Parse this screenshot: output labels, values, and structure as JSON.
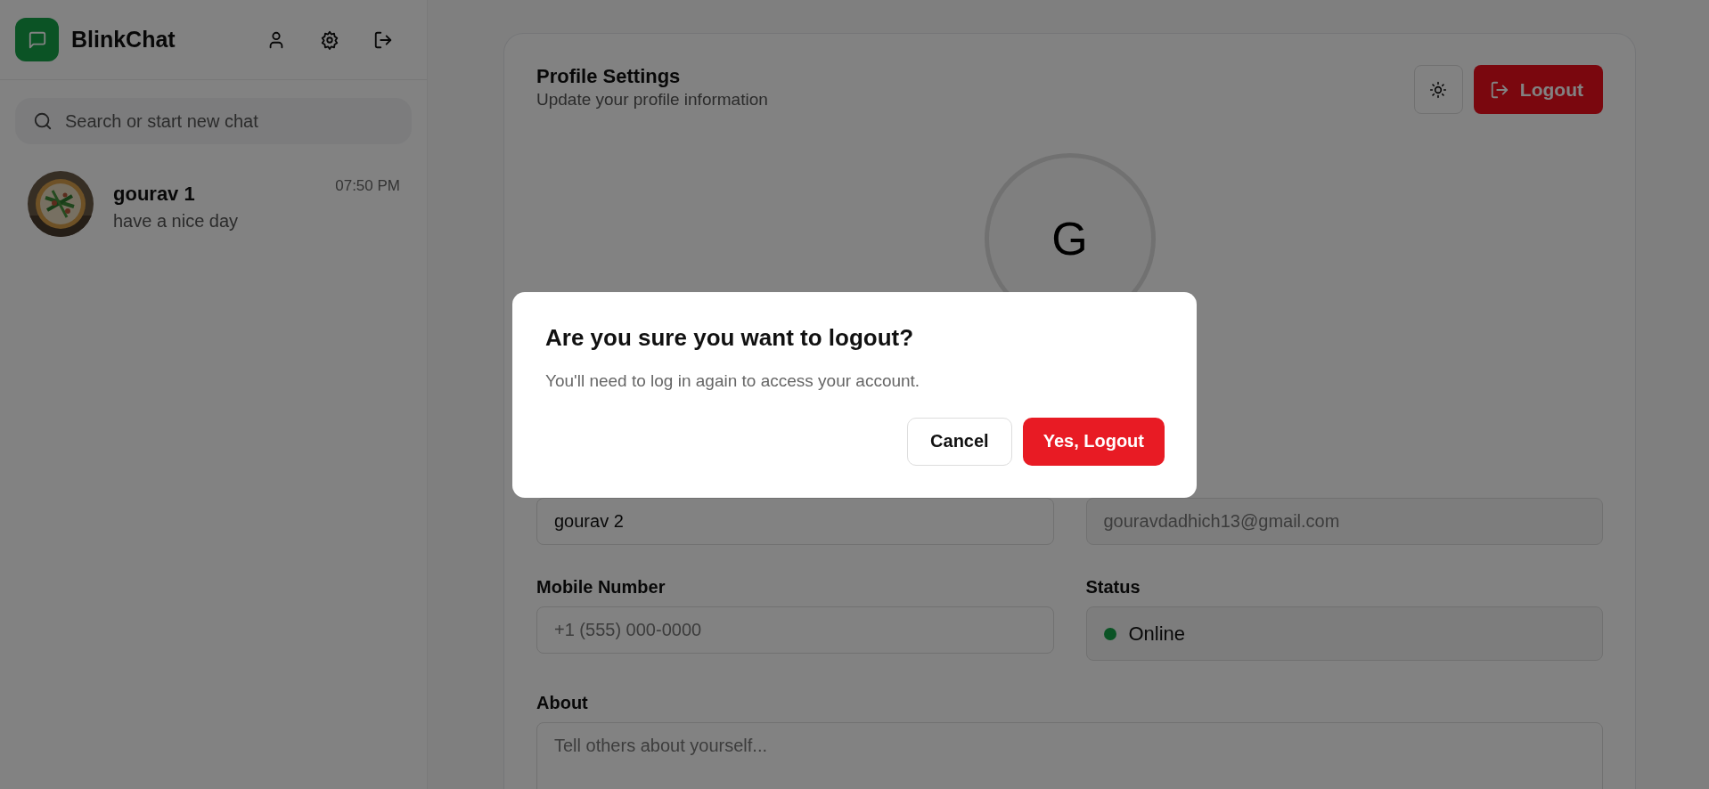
{
  "app": {
    "name": "BlinkChat"
  },
  "search": {
    "placeholder": "Search or start new chat"
  },
  "chats": [
    {
      "name": "gourav 1",
      "time": "07:50 PM",
      "preview": "have a nice day"
    }
  ],
  "profile": {
    "title": "Profile Settings",
    "subtitle": "Update your profile information",
    "logout_label": "Logout",
    "avatar_initial": "G"
  },
  "fields": [
    {
      "kind": "text",
      "value": "gourav 2"
    },
    {
      "kind": "text",
      "value": "gouravdadhich13@gmail.com",
      "disabled": true
    },
    {
      "kind": "text",
      "label": "Mobile Number",
      "placeholder": "+1 (555) 000-0000"
    },
    {
      "kind": "status",
      "label": "Status",
      "value": "Online",
      "online": true
    },
    {
      "kind": "textarea",
      "label": "About",
      "placeholder": "Tell others about yourself..."
    }
  ],
  "dialog": {
    "title": "Are you sure you want to logout?",
    "message": "You'll need to log in again to access your account.",
    "cancel": "Cancel",
    "confirm": "Yes, Logout"
  }
}
